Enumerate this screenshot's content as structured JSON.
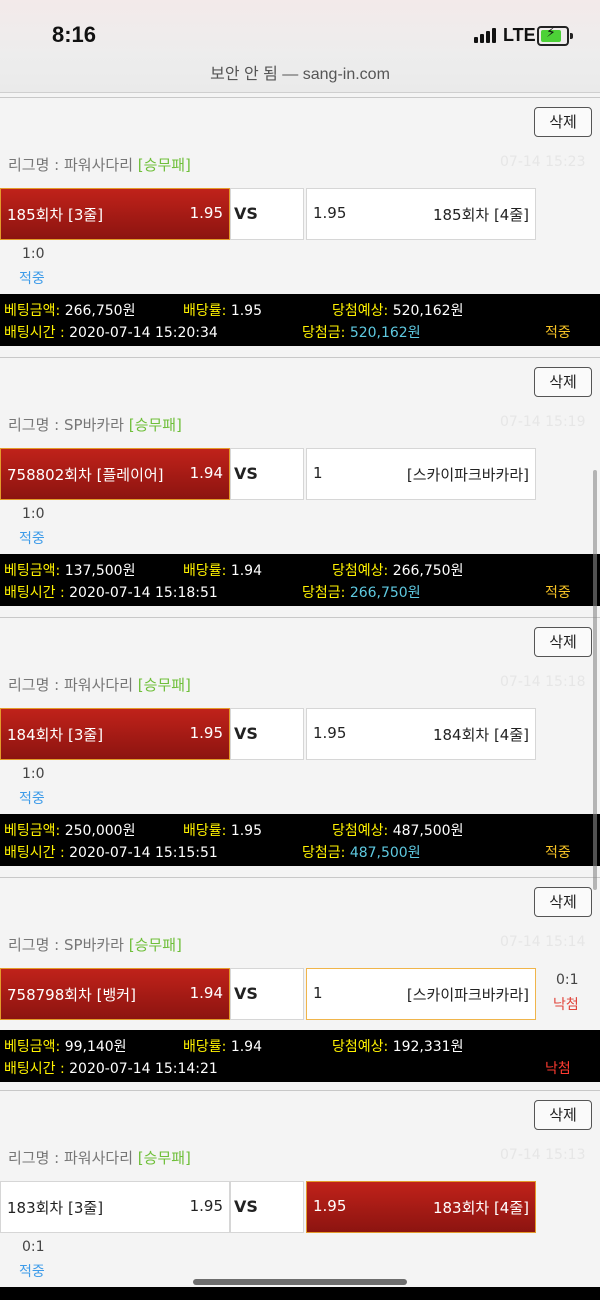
{
  "status": {
    "time": "8:16",
    "network": "LTE",
    "url": "보안 안 됨 — sang-in.com"
  },
  "labels": {
    "delete": "삭제",
    "league_prefix": "리그명 : ",
    "vs": "VS",
    "bet_amount": "베팅금액: ",
    "odds": "배당률: ",
    "expected": "당첨예상: ",
    "bet_time": "배팅시간 : ",
    "win_amount": "당첨금: "
  },
  "bets": [
    {
      "league": "파워사다리",
      "type": "[승무패]",
      "time": "07-14 15:23",
      "home": {
        "name": "185회차 [3줄]",
        "odds": "1.95"
      },
      "away": {
        "name": "185회차 [4줄]",
        "odds": "1.95"
      },
      "score": "1:0",
      "result": "적중",
      "amount": "266,750원",
      "rate": "1.95",
      "expected": "520,162원",
      "bet_time": "2020-07-14 15:20:34",
      "win": "520,162원",
      "status": "적중"
    },
    {
      "league": "SP바카라",
      "type": "[승무패]",
      "time": "07-14 15:19",
      "home": {
        "name": "758802회차 [플레이어]",
        "odds": "1.94"
      },
      "away": {
        "name": "[스카이파크바카라]",
        "odds": "1"
      },
      "score": "1:0",
      "result": "적중",
      "amount": "137,500원",
      "rate": "1.94",
      "expected": "266,750원",
      "bet_time": "2020-07-14 15:18:51",
      "win": "266,750원",
      "status": "적중"
    },
    {
      "league": "파워사다리",
      "type": "[승무패]",
      "time": "07-14 15:18",
      "home": {
        "name": "184회차 [3줄]",
        "odds": "1.95"
      },
      "away": {
        "name": "184회차 [4줄]",
        "odds": "1.95"
      },
      "score": "1:0",
      "result": "적중",
      "amount": "250,000원",
      "rate": "1.95",
      "expected": "487,500원",
      "bet_time": "2020-07-14 15:15:51",
      "win": "487,500원",
      "status": "적중"
    },
    {
      "league": "SP바카라",
      "type": "[승무패]",
      "time": "07-14 15:14",
      "home": {
        "name": "758798회차 [뱅커]",
        "odds": "1.94"
      },
      "away": {
        "name": "[스카이파크바카라]",
        "odds": "1"
      },
      "score": "0:1",
      "result": "낙첨",
      "amount": "99,140원",
      "rate": "1.94",
      "expected": "192,331원",
      "bet_time": "2020-07-14 15:14:21",
      "status": "낙첨"
    },
    {
      "league": "파워사다리",
      "type": "[승무패]",
      "time": "07-14 15:13",
      "home": {
        "name": "183회차 [3줄]",
        "odds": "1.95"
      },
      "away": {
        "name": "183회차 [4줄]",
        "odds": "1.95"
      },
      "score": "0:1",
      "result": "적중"
    }
  ]
}
